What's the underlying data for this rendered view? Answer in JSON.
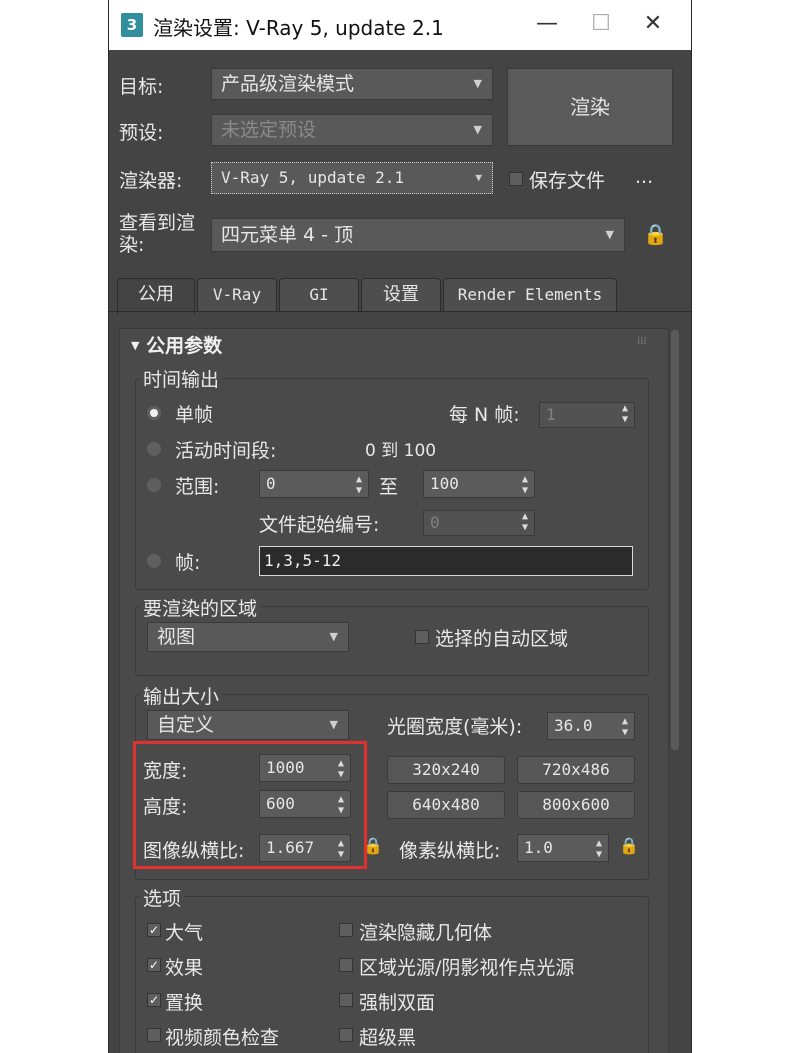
{
  "window": {
    "title": "渲染设置: V-Ray 5, update 2.1",
    "app_icon": "3",
    "min_glyph": "—",
    "max_glyph": "☐",
    "close_glyph": "✕"
  },
  "top": {
    "target_label": "目标:",
    "target_value": "产品级渲染模式",
    "preset_label": "预设:",
    "preset_value": "未选定预设",
    "renderer_label": "渲染器:",
    "renderer_value": "V-Ray 5, update 2.1",
    "save_file_label": "保存文件",
    "more_label": "...",
    "view_label_1": "查看到渲",
    "view_label_2": "染:",
    "view_value": "四元菜单 4 - 顶",
    "render_button": "渲染"
  },
  "tabs": [
    {
      "label": "公用"
    },
    {
      "label": "V-Ray"
    },
    {
      "label": "GI"
    },
    {
      "label": "设置"
    },
    {
      "label": "Render Elements"
    }
  ],
  "rollout": {
    "title": "公用参数",
    "collapse_glyph": "▼",
    "grip_glyph": "⁞⁞⁞"
  },
  "time_output": {
    "title": "时间输出",
    "single_label": "单帧",
    "every_n_label": "每 N 帧:",
    "every_n_value": "1",
    "active_label": "活动时间段:",
    "active_range": "0 到 100",
    "range_label": "范围:",
    "range_start": "0",
    "range_to": "至",
    "range_end": "100",
    "file_start_label": "文件起始编号:",
    "file_start_value": "0",
    "frames_label": "帧:",
    "frames_value": "1,3,5-12"
  },
  "area": {
    "title": "要渲染的区域",
    "value": "视图",
    "auto_region_label": "选择的自动区域"
  },
  "output_size": {
    "title": "输出大小",
    "preset_value": "自定义",
    "aperture_label": "光圈宽度(毫米):",
    "aperture_value": "36.0",
    "width_label": "宽度:",
    "width_value": "1000",
    "height_label": "高度:",
    "height_value": "600",
    "aspect_label": "图像纵横比:",
    "aspect_value": "1.667",
    "pixel_aspect_label": "像素纵横比:",
    "pixel_aspect_value": "1.0",
    "presets": [
      "320x240",
      "720x486",
      "640x480",
      "800x600"
    ]
  },
  "options": {
    "title": "选项",
    "items": [
      {
        "label": "大气",
        "checked": true
      },
      {
        "label": "渲染隐藏几何体",
        "checked": false
      },
      {
        "label": "效果",
        "checked": true
      },
      {
        "label": "区域光源/阴影视作点光源",
        "checked": false
      },
      {
        "label": "置换",
        "checked": true
      },
      {
        "label": "强制双面",
        "checked": false
      },
      {
        "label": "视频颜色检查",
        "checked": false
      },
      {
        "label": "超级黑",
        "checked": false
      }
    ]
  },
  "glyphs": {
    "dropdown_arrow": "▼",
    "spin_arrows": "▲▼",
    "check": "✓",
    "lock": "🔒"
  },
  "colors": {
    "panel_bg": "#444444",
    "highlight_box": "#e0312e"
  }
}
